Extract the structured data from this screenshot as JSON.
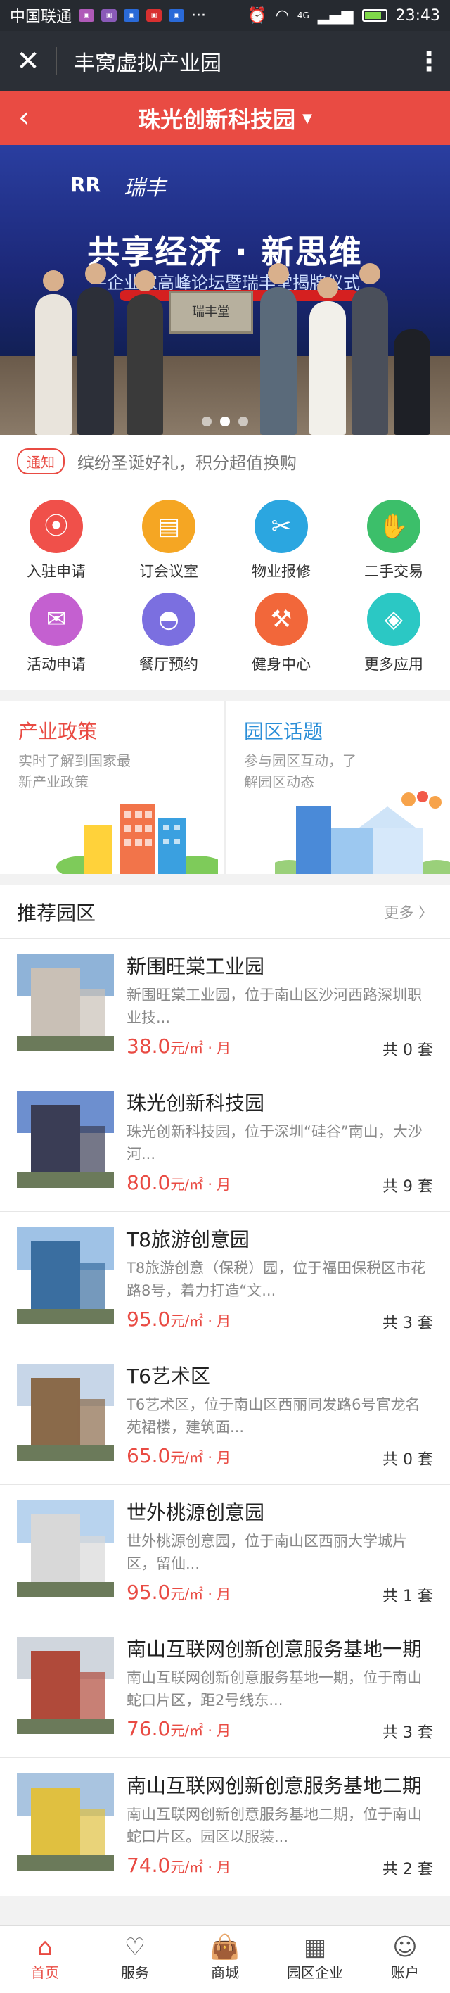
{
  "status_bar": {
    "carrier": "中国联通",
    "network": "4G",
    "time": "23:43",
    "battery_level": 0.85
  },
  "app_bar": {
    "title": "丰窝虚拟产业园"
  },
  "park_selector": {
    "name": "珠光创新科技园"
  },
  "banner": {
    "headline": "共享经济 · 新思维",
    "subline": "—企业家高峰论坛暨瑞丰堂揭牌仪式",
    "brand": "RR",
    "plaque": "瑞丰堂",
    "slide_count": 3,
    "active_slide": 2
  },
  "notice": {
    "tag": "通知",
    "text": "缤纷圣诞好礼，积分超值换购"
  },
  "services": [
    {
      "label": "入驻申请",
      "icon": "location-pin-icon",
      "color": "#f0504a"
    },
    {
      "label": "订会议室",
      "icon": "meeting-room-icon",
      "color": "#f5a623"
    },
    {
      "label": "物业报修",
      "icon": "repair-tools-icon",
      "color": "#2ba6e0"
    },
    {
      "label": "二手交易",
      "icon": "handshake-icon",
      "color": "#3cbf6a"
    },
    {
      "label": "活动申请",
      "icon": "event-mail-icon",
      "color": "#c460d0"
    },
    {
      "label": "餐厅预约",
      "icon": "restaurant-cloche-icon",
      "color": "#7b6fe0"
    },
    {
      "label": "健身中心",
      "icon": "dumbbell-icon",
      "color": "#f2673a"
    },
    {
      "label": "更多应用",
      "icon": "box-icon",
      "color": "#2bc8c4"
    }
  ],
  "cards": [
    {
      "title": "产业政策",
      "desc": "实时了解到国家最新产业政策",
      "title_color": "#e94b43"
    },
    {
      "title": "园区话题",
      "desc": "参与园区互动，了解园区动态",
      "title_color": "#2b8fd8"
    }
  ],
  "recommend": {
    "title": "推荐园区",
    "more": "更多 〉"
  },
  "parks": [
    {
      "name": "新围旺棠工业园",
      "desc": "新围旺棠工业园，位于南山区沙河西路深圳职业技...",
      "price": "38.0",
      "unit": "元/㎡ · 月",
      "count": "共 0 套",
      "sky": "#8fb3d8",
      "building": "#c9c0b6"
    },
    {
      "name": "珠光创新科技园",
      "desc": "珠光创新科技园，位于深圳“硅谷”南山，大沙河...",
      "price": "80.0",
      "unit": "元/㎡ · 月",
      "count": "共 9 套",
      "sky": "#6d8fcf",
      "building": "#3a3d55"
    },
    {
      "name": "T8旅游创意园",
      "desc": "T8旅游创意（保税）园，位于福田保税区市花路8号，着力打造“文...",
      "price": "95.0",
      "unit": "元/㎡ · 月",
      "count": "共 3 套",
      "sky": "#9fc2e6",
      "building": "#3a6ea0"
    },
    {
      "name": "T6艺术区",
      "desc": "T6艺术区，位于南山区西丽同发路6号官龙名苑裙楼，建筑面...",
      "price": "65.0",
      "unit": "元/㎡ · 月",
      "count": "共 0 套",
      "sky": "#c7d6e8",
      "building": "#8a6a4a"
    },
    {
      "name": "世外桃源创意园",
      "desc": "世外桃源创意园，位于南山区西丽大学城片区，留仙...",
      "price": "95.0",
      "unit": "元/㎡ · 月",
      "count": "共 1 套",
      "sky": "#b8d3ee",
      "building": "#d8d8d8"
    },
    {
      "name": "南山互联网创新创意服务基地一期",
      "desc": "南山互联网创新创意服务基地一期，位于南山蛇口片区，距2号线东...",
      "price": "76.0",
      "unit": "元/㎡ · 月",
      "count": "共 3 套",
      "sky": "#d0d6dd",
      "building": "#b04a3a"
    },
    {
      "name": "南山互联网创新创意服务基地二期",
      "desc": "南山互联网创新创意服务基地二期，位于南山蛇口片区。园区以服装...",
      "price": "74.0",
      "unit": "元/㎡ · 月",
      "count": "共 2 套",
      "sky": "#a9c4e0",
      "building": "#e0c040"
    }
  ],
  "tabs": [
    {
      "label": "首页",
      "icon": "home-icon",
      "glyph": "⌂",
      "active": true
    },
    {
      "label": "服务",
      "icon": "heart-icon",
      "glyph": "♡",
      "active": false
    },
    {
      "label": "商城",
      "icon": "shopping-bag-icon",
      "glyph": "👜",
      "active": false
    },
    {
      "label": "园区企业",
      "icon": "building-icon",
      "glyph": "▦",
      "active": false
    },
    {
      "label": "账户",
      "icon": "user-icon",
      "glyph": "☺",
      "active": false
    }
  ]
}
